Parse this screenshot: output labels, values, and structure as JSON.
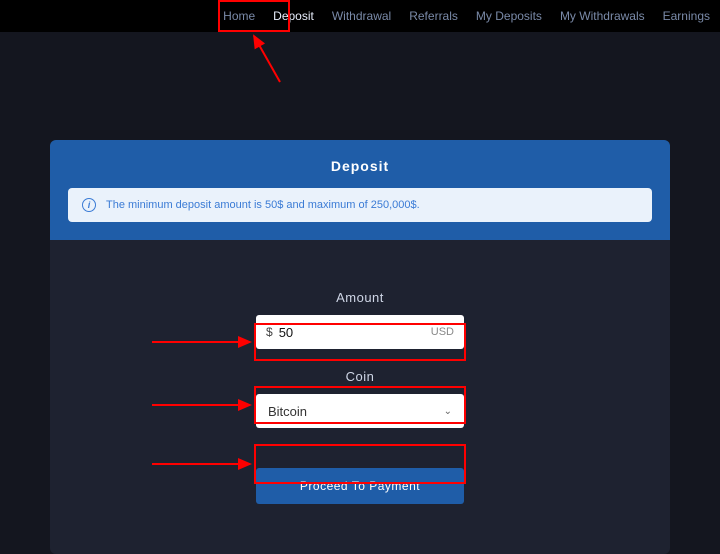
{
  "nav": {
    "items": [
      {
        "label": "Home"
      },
      {
        "label": "Deposit"
      },
      {
        "label": "Withdrawal"
      },
      {
        "label": "Referrals"
      },
      {
        "label": "My Deposits"
      },
      {
        "label": "My Withdrawals"
      },
      {
        "label": "Earnings"
      }
    ],
    "active_index": 1
  },
  "card": {
    "title": "Deposit",
    "info_text": "The minimum deposit amount is 50$ and maximum of 250,000$."
  },
  "form": {
    "amount": {
      "label": "Amount",
      "prefix": "$",
      "value": "50",
      "suffix": "USD"
    },
    "coin": {
      "label": "Coin",
      "selected": "Bitcoin"
    },
    "submit_label": "Proceed To Payment"
  },
  "icons": {
    "info_glyph": "i",
    "chevron_glyph": "⌄"
  }
}
